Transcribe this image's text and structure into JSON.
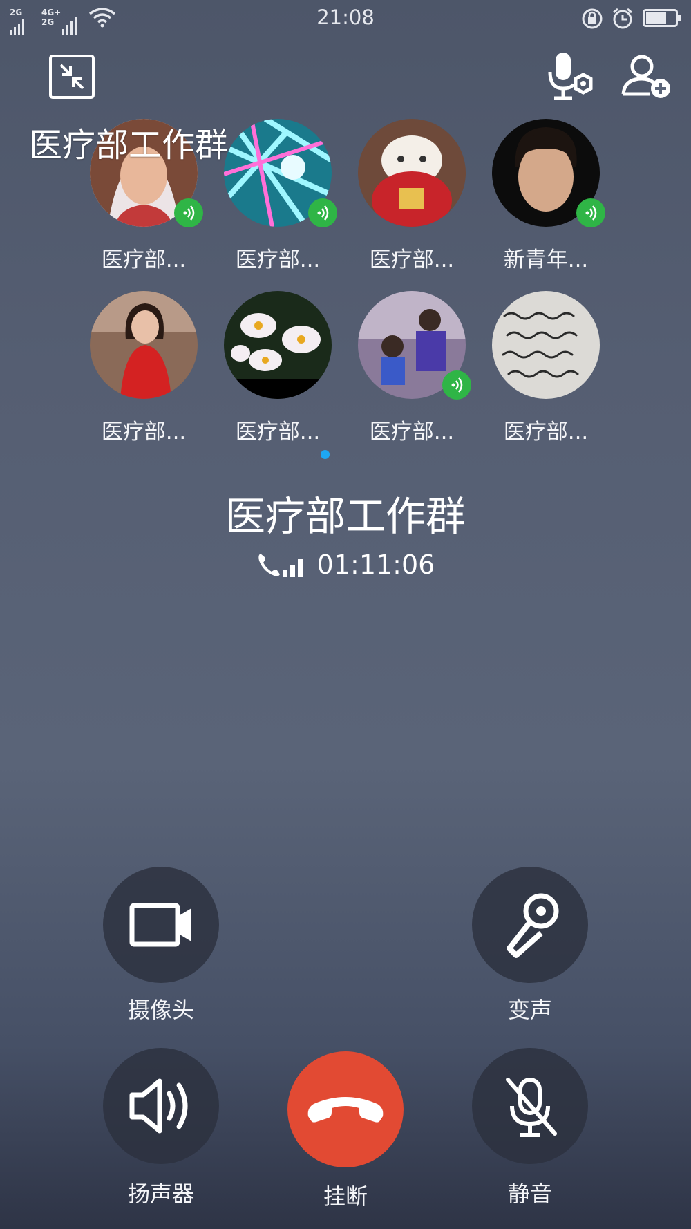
{
  "status_bar": {
    "signal_1_label": "2G",
    "signal_2_label_top": "4G+",
    "signal_2_label_bottom": "2G",
    "time": "21:08",
    "icons": [
      "signal-icon",
      "wifi-icon",
      "rotation-lock-icon",
      "alarm-icon",
      "battery-icon"
    ],
    "battery_level": 0.7
  },
  "header": {
    "overlay_title": "医疗部工作群",
    "icons": [
      "collapse-icon",
      "mic-settings-icon",
      "add-member-icon"
    ]
  },
  "members": [
    {
      "name": "医疗部...",
      "speaking": true
    },
    {
      "name": "医疗部...",
      "speaking": true
    },
    {
      "name": "医疗部...",
      "speaking": false
    },
    {
      "name": "新青年...",
      "speaking": true
    },
    {
      "name": "医疗部...",
      "speaking": false
    },
    {
      "name": "医疗部...",
      "speaking": false
    },
    {
      "name": "医疗部...",
      "speaking": true
    },
    {
      "name": "医疗部...",
      "speaking": false
    }
  ],
  "call": {
    "title": "医疗部工作群",
    "duration": "01:11:06"
  },
  "controls": {
    "camera_label": "摄像头",
    "voice_changer_label": "变声",
    "speaker_label": "扬声器",
    "hangup_label": "挂断",
    "mute_label": "静音"
  },
  "colors": {
    "speaking_badge": "#2fb546",
    "hangup": "#e24a33",
    "page_dot": "#1ea7f2"
  }
}
